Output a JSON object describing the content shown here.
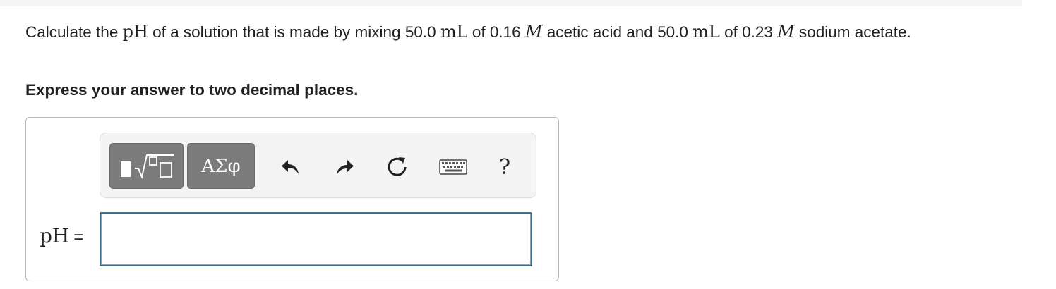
{
  "question": {
    "t1": "Calculate the ",
    "m1": "pH",
    "t2": " of a solution that is made by mixing 50.0 ",
    "m2": "mL",
    "t3": " of 0.16 ",
    "m3": "M",
    "t4": " acetic acid and 50.0 ",
    "m4": "mL",
    "t5": " of 0.23 ",
    "m5": "M",
    "t6": " sodium acetate."
  },
  "instruction": "Express your answer to two decimal places.",
  "toolbar": {
    "templates_icon": "templates-icon",
    "symbols_label": "ΑΣφ",
    "undo_icon": "undo-icon",
    "redo_icon": "redo-icon",
    "reset_icon": "reset-icon",
    "keyboard_icon": "keyboard-icon",
    "help_label": "?"
  },
  "answer": {
    "label": "pH",
    "equals": "=",
    "value": "",
    "placeholder": ""
  }
}
